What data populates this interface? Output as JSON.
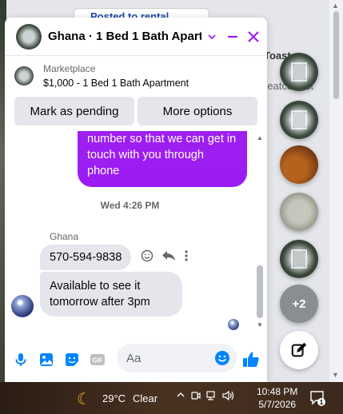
{
  "background": {
    "top_button_text": "Posted to rental",
    "right_text_1": "Toast",
    "right_text_2": "reatcorrect"
  },
  "chat": {
    "title": "Ghana · 1 Bed 1 Bath Apart...",
    "listing_category": "Marketplace",
    "listing_title": "$1,000 - 1 Bed 1 Bath Apartment",
    "buttons": {
      "mark_pending": "Mark as pending",
      "more_options": "More options"
    },
    "messages": {
      "outgoing_partial": "number so that we can get in touch with you through phone",
      "timestamp": "Wed 4:26 PM",
      "sender_name": "Ghana",
      "incoming_1": "570-594-9838",
      "incoming_2": "Available to see it tomorrow after 3pm"
    },
    "composer_placeholder": "Aa"
  },
  "chatheads": {
    "more_count": "+2"
  },
  "taskbar": {
    "temperature": "29°C",
    "condition": "Clear",
    "time": "10:48 PM",
    "date": "5/7/2026",
    "notification_count": "1"
  },
  "colors": {
    "accent": "#0084ff",
    "outgoing_bubble": "#9a1cf2",
    "close": "#a020f0"
  }
}
